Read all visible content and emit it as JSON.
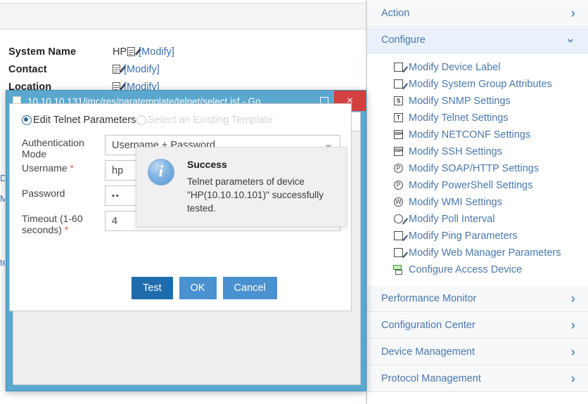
{
  "background_page": {
    "properties": [
      {
        "label": "System Name",
        "value": "HP",
        "icon": "edit-icon",
        "link": "[Modify]"
      },
      {
        "label": "Contact",
        "value": "",
        "icon": "edit-icon",
        "link": "[Modify]"
      },
      {
        "label": "Location",
        "value": "",
        "icon": "edit-icon",
        "link": "[Modify]"
      }
    ]
  },
  "browser_window": {
    "title": "10.10.10.131/imc/res/paratemplate/telnet/select.jsf - Go...",
    "favicon": "document-icon",
    "controls": {
      "minimize": "–",
      "maximize": "□",
      "close": "×"
    },
    "url": {
      "host": "10.10.10.131",
      "path": "/imc/res/paratemplate/telnet/select.jsf"
    }
  },
  "form": {
    "radio_options": [
      {
        "label": "Edit Telnet Parameters",
        "selected": true
      },
      {
        "label": "Select an Existing Template",
        "selected": false
      }
    ],
    "fields": [
      {
        "label": "Authentication Mode",
        "required": false,
        "type": "select",
        "value": "Username + Password"
      },
      {
        "label": "Username",
        "required": true,
        "type": "text",
        "value": "hp"
      },
      {
        "label": "Password",
        "required": false,
        "type": "password",
        "value": "••"
      },
      {
        "label": "Timeout (1-60 seconds)",
        "required": true,
        "type": "text",
        "value": "4"
      }
    ],
    "buttons": [
      {
        "label": "Test",
        "style": "primary-dark"
      },
      {
        "label": "OK",
        "style": "primary"
      },
      {
        "label": "Cancel",
        "style": "primary"
      }
    ]
  },
  "toast": {
    "icon": "info-icon",
    "title": "Success",
    "message": "Telnet parameters of device \"HP(10.10.10.101)\" successfully tested."
  },
  "sidebar": {
    "sections": [
      {
        "label": "Action",
        "state": "collapsed",
        "chevron": "chevron-right-icon"
      },
      {
        "label": "Configure",
        "state": "expanded",
        "chevron": "chevron-down-icon"
      },
      {
        "label": "Performance Monitor",
        "state": "collapsed",
        "chevron": "chevron-right-icon"
      },
      {
        "label": "Configuration Center",
        "state": "collapsed",
        "chevron": "chevron-right-icon"
      },
      {
        "label": "Device Management",
        "state": "collapsed",
        "chevron": "chevron-right-icon"
      },
      {
        "label": "Protocol Management",
        "state": "collapsed",
        "chevron": "chevron-right-icon"
      }
    ],
    "configure_items": [
      {
        "label": "Modify Device Label",
        "icon": "edit-document-icon",
        "glyph": ""
      },
      {
        "label": "Modify System Group Attributes",
        "icon": "edit-document-icon",
        "glyph": ""
      },
      {
        "label": "Modify SNMP Settings",
        "icon": "snmp-icon",
        "glyph": "S"
      },
      {
        "label": "Modify Telnet Settings",
        "icon": "telnet-icon",
        "glyph": "T"
      },
      {
        "label": "Modify NETCONF Settings",
        "icon": "netconf-icon",
        "glyph": "SSH"
      },
      {
        "label": "Modify SSH Settings",
        "icon": "ssh-icon",
        "glyph": "SSH"
      },
      {
        "label": "Modify SOAP/HTTP Settings",
        "icon": "soap-http-icon",
        "glyph": "P"
      },
      {
        "label": "Modify PowerShell Settings",
        "icon": "powershell-icon",
        "glyph": "P"
      },
      {
        "label": "Modify WMI Settings",
        "icon": "wmi-icon",
        "glyph": "W"
      },
      {
        "label": "Modify Poll Interval",
        "icon": "poll-interval-icon",
        "glyph": ""
      },
      {
        "label": "Modify Ping Parameters",
        "icon": "ping-icon",
        "glyph": ""
      },
      {
        "label": "Modify Web Manager Parameters",
        "icon": "web-manager-icon",
        "glyph": ""
      },
      {
        "label": "Configure Access Device",
        "icon": "access-device-icon",
        "glyph": ""
      }
    ]
  },
  "colors": {
    "window_frame": "#5aa8cf",
    "close_button": "#d44040",
    "link_blue": "#4a78ad",
    "button_dark": "#1f6cad",
    "button_light": "#4a91cf",
    "active_section": "#eaf1fa"
  }
}
